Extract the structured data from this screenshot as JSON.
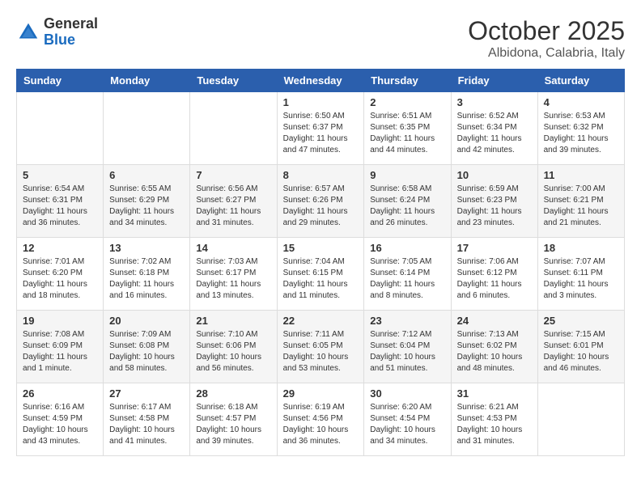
{
  "header": {
    "logo_general": "General",
    "logo_blue": "Blue",
    "month_title": "October 2025",
    "location": "Albidona, Calabria, Italy"
  },
  "days_of_week": [
    "Sunday",
    "Monday",
    "Tuesday",
    "Wednesday",
    "Thursday",
    "Friday",
    "Saturday"
  ],
  "weeks": [
    [
      {
        "day": "",
        "info": ""
      },
      {
        "day": "",
        "info": ""
      },
      {
        "day": "",
        "info": ""
      },
      {
        "day": "1",
        "info": "Sunrise: 6:50 AM\nSunset: 6:37 PM\nDaylight: 11 hours\nand 47 minutes."
      },
      {
        "day": "2",
        "info": "Sunrise: 6:51 AM\nSunset: 6:35 PM\nDaylight: 11 hours\nand 44 minutes."
      },
      {
        "day": "3",
        "info": "Sunrise: 6:52 AM\nSunset: 6:34 PM\nDaylight: 11 hours\nand 42 minutes."
      },
      {
        "day": "4",
        "info": "Sunrise: 6:53 AM\nSunset: 6:32 PM\nDaylight: 11 hours\nand 39 minutes."
      }
    ],
    [
      {
        "day": "5",
        "info": "Sunrise: 6:54 AM\nSunset: 6:31 PM\nDaylight: 11 hours\nand 36 minutes."
      },
      {
        "day": "6",
        "info": "Sunrise: 6:55 AM\nSunset: 6:29 PM\nDaylight: 11 hours\nand 34 minutes."
      },
      {
        "day": "7",
        "info": "Sunrise: 6:56 AM\nSunset: 6:27 PM\nDaylight: 11 hours\nand 31 minutes."
      },
      {
        "day": "8",
        "info": "Sunrise: 6:57 AM\nSunset: 6:26 PM\nDaylight: 11 hours\nand 29 minutes."
      },
      {
        "day": "9",
        "info": "Sunrise: 6:58 AM\nSunset: 6:24 PM\nDaylight: 11 hours\nand 26 minutes."
      },
      {
        "day": "10",
        "info": "Sunrise: 6:59 AM\nSunset: 6:23 PM\nDaylight: 11 hours\nand 23 minutes."
      },
      {
        "day": "11",
        "info": "Sunrise: 7:00 AM\nSunset: 6:21 PM\nDaylight: 11 hours\nand 21 minutes."
      }
    ],
    [
      {
        "day": "12",
        "info": "Sunrise: 7:01 AM\nSunset: 6:20 PM\nDaylight: 11 hours\nand 18 minutes."
      },
      {
        "day": "13",
        "info": "Sunrise: 7:02 AM\nSunset: 6:18 PM\nDaylight: 11 hours\nand 16 minutes."
      },
      {
        "day": "14",
        "info": "Sunrise: 7:03 AM\nSunset: 6:17 PM\nDaylight: 11 hours\nand 13 minutes."
      },
      {
        "day": "15",
        "info": "Sunrise: 7:04 AM\nSunset: 6:15 PM\nDaylight: 11 hours\nand 11 minutes."
      },
      {
        "day": "16",
        "info": "Sunrise: 7:05 AM\nSunset: 6:14 PM\nDaylight: 11 hours\nand 8 minutes."
      },
      {
        "day": "17",
        "info": "Sunrise: 7:06 AM\nSunset: 6:12 PM\nDaylight: 11 hours\nand 6 minutes."
      },
      {
        "day": "18",
        "info": "Sunrise: 7:07 AM\nSunset: 6:11 PM\nDaylight: 11 hours\nand 3 minutes."
      }
    ],
    [
      {
        "day": "19",
        "info": "Sunrise: 7:08 AM\nSunset: 6:09 PM\nDaylight: 11 hours\nand 1 minute."
      },
      {
        "day": "20",
        "info": "Sunrise: 7:09 AM\nSunset: 6:08 PM\nDaylight: 10 hours\nand 58 minutes."
      },
      {
        "day": "21",
        "info": "Sunrise: 7:10 AM\nSunset: 6:06 PM\nDaylight: 10 hours\nand 56 minutes."
      },
      {
        "day": "22",
        "info": "Sunrise: 7:11 AM\nSunset: 6:05 PM\nDaylight: 10 hours\nand 53 minutes."
      },
      {
        "day": "23",
        "info": "Sunrise: 7:12 AM\nSunset: 6:04 PM\nDaylight: 10 hours\nand 51 minutes."
      },
      {
        "day": "24",
        "info": "Sunrise: 7:13 AM\nSunset: 6:02 PM\nDaylight: 10 hours\nand 48 minutes."
      },
      {
        "day": "25",
        "info": "Sunrise: 7:15 AM\nSunset: 6:01 PM\nDaylight: 10 hours\nand 46 minutes."
      }
    ],
    [
      {
        "day": "26",
        "info": "Sunrise: 6:16 AM\nSunset: 4:59 PM\nDaylight: 10 hours\nand 43 minutes."
      },
      {
        "day": "27",
        "info": "Sunrise: 6:17 AM\nSunset: 4:58 PM\nDaylight: 10 hours\nand 41 minutes."
      },
      {
        "day": "28",
        "info": "Sunrise: 6:18 AM\nSunset: 4:57 PM\nDaylight: 10 hours\nand 39 minutes."
      },
      {
        "day": "29",
        "info": "Sunrise: 6:19 AM\nSunset: 4:56 PM\nDaylight: 10 hours\nand 36 minutes."
      },
      {
        "day": "30",
        "info": "Sunrise: 6:20 AM\nSunset: 4:54 PM\nDaylight: 10 hours\nand 34 minutes."
      },
      {
        "day": "31",
        "info": "Sunrise: 6:21 AM\nSunset: 4:53 PM\nDaylight: 10 hours\nand 31 minutes."
      },
      {
        "day": "",
        "info": ""
      }
    ]
  ]
}
